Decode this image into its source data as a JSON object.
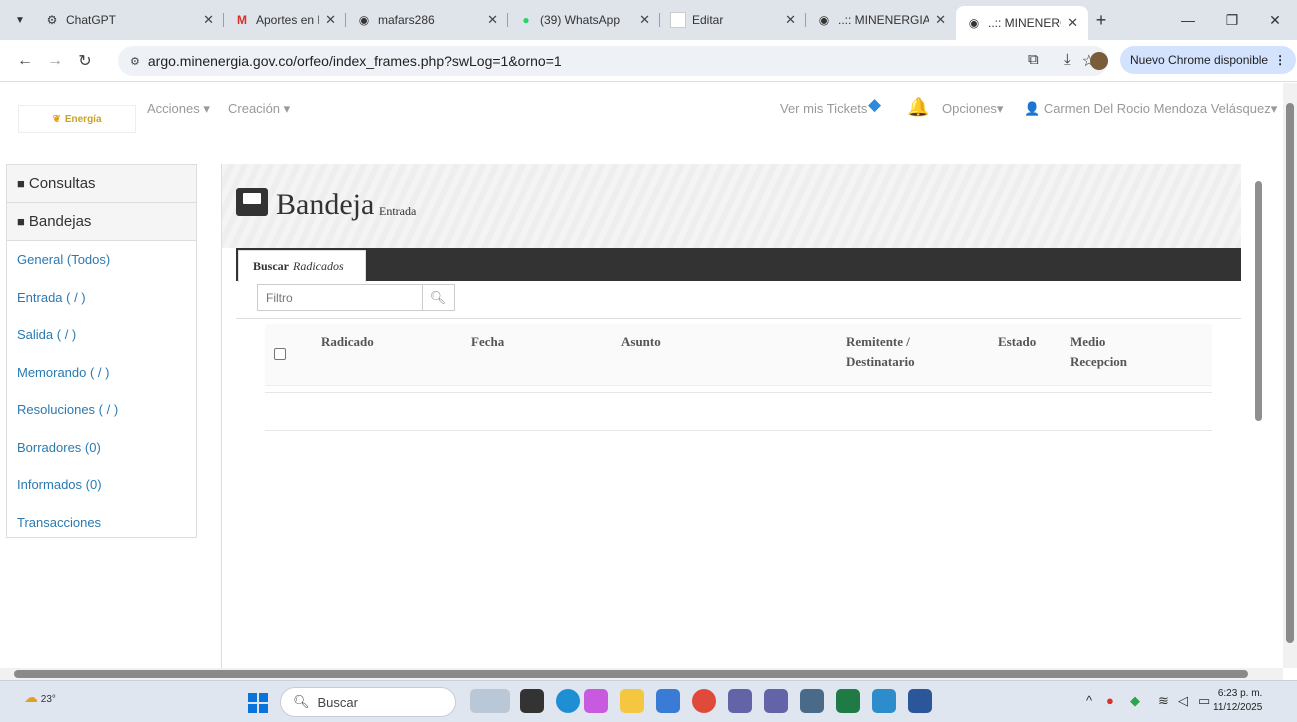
{
  "browser": {
    "tabs": [
      {
        "title": "ChatGPT",
        "icon": "chatgpt-icon"
      },
      {
        "title": "Aportes en Línea",
        "icon": "gmail-icon"
      },
      {
        "title": "mafars286",
        "icon": "globe-icon"
      },
      {
        "title": "(39) WhatsApp",
        "icon": "whatsapp-icon"
      },
      {
        "title": "Editar",
        "icon": "blank-page-icon"
      },
      {
        "title": "..:: MINENERGIA",
        "icon": "globe-icon"
      },
      {
        "title": "..:: MINENERGIA",
        "icon": "globe-icon"
      }
    ],
    "url": "argo.minenergia.gov.co/orfeo/index_frames.php?swLog=1&orno=1",
    "update_button": "Nuevo Chrome disponible"
  },
  "app": {
    "logo_text": "Energía",
    "menu": [
      "Acciones",
      "Creación"
    ],
    "tickets": "Ver mis Tickets",
    "options": "Opciones",
    "user": "Carmen Del Rocio Mendoza Velásquez"
  },
  "sidebar": {
    "consultas": "Consultas",
    "bandejas": "Bandejas",
    "links": [
      "General (Todos)",
      "Entrada ( / )",
      "Salida ( / )",
      "Memorando ( / )",
      "Resoluciones ( / )",
      "Borradores (0)",
      "Informados (0)",
      "Transacciones"
    ]
  },
  "main": {
    "title": "Bandeja",
    "subtitle": "Entrada",
    "tab_bold": "Buscar",
    "tab_italic": "Radicados",
    "filter_placeholder": "Filtro",
    "columns": [
      "Radicado",
      "Fecha",
      "Asunto",
      "Remitente /",
      "Destinatario",
      "Estado",
      "Medio",
      "Recepcion"
    ]
  },
  "taskbar": {
    "temperature": "23°",
    "search": "Buscar",
    "time": "6:23 p. m.",
    "date": "11/12/2025"
  },
  "colors": {
    "link": "#2a7ab0",
    "accent_blue": "#2b8ad9",
    "bell": "#d9312b",
    "tabstrip": "#333333"
  }
}
